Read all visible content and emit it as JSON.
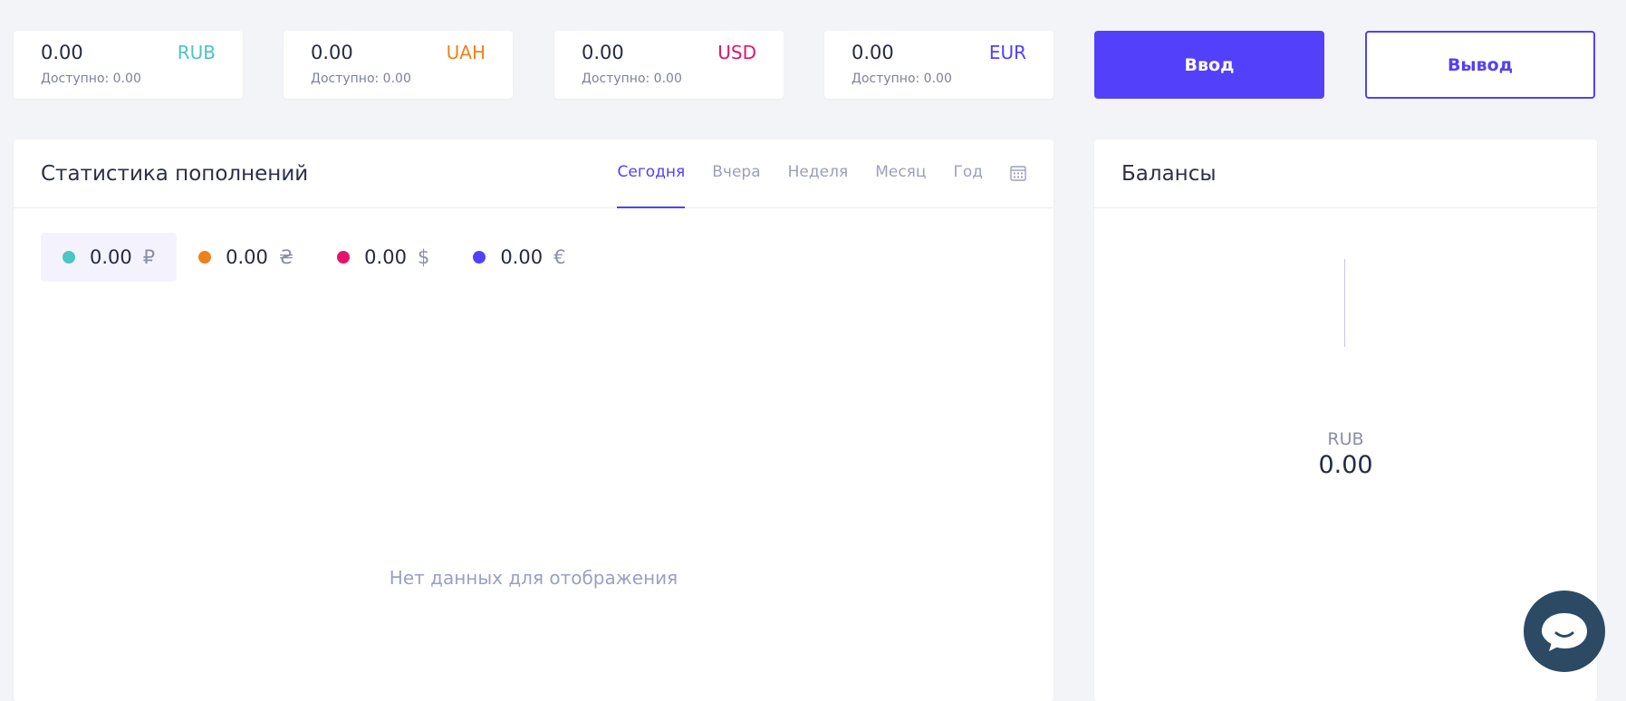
{
  "balances": [
    {
      "amount": "0.00",
      "code": "RUB",
      "available": "Доступно: 0.00",
      "color": "#4cc5c5"
    },
    {
      "amount": "0.00",
      "code": "UAH",
      "available": "Доступно: 0.00",
      "color": "#f0811a"
    },
    {
      "amount": "0.00",
      "code": "USD",
      "available": "Доступно: 0.00",
      "color": "#e2156b"
    },
    {
      "amount": "0.00",
      "code": "EUR",
      "available": "Доступно: 0.00",
      "color": "#5340fb"
    }
  ],
  "actions": {
    "deposit": "Ввод",
    "withdraw": "Вывод"
  },
  "stats": {
    "title": "Статистика пополнений",
    "tabs": [
      "Сегодня",
      "Вчера",
      "Неделя",
      "Месяц",
      "Год"
    ],
    "active_tab": "Сегодня",
    "calendar_icon": "calendar-icon",
    "legend": [
      {
        "value": "0.00",
        "symbol": "₽",
        "color": "#4cc5c5"
      },
      {
        "value": "0.00",
        "symbol": "₴",
        "color": "#f0811a"
      },
      {
        "value": "0.00",
        "symbol": "$",
        "color": "#e2156b"
      },
      {
        "value": "0.00",
        "symbol": "€",
        "color": "#5340fb"
      }
    ],
    "empty_text": "Нет данных для отображения"
  },
  "balances_panel": {
    "title": "Балансы",
    "code": "RUB",
    "value": "0.00"
  },
  "chat_icon": "chat-bubble-icon"
}
